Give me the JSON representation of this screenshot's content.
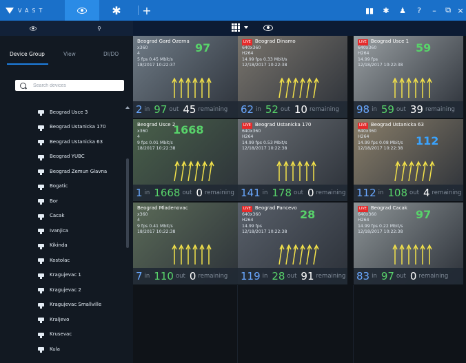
{
  "app": {
    "logo_text": "VAST"
  },
  "toolbar": {
    "colors": {
      "accent": "#1a70c9",
      "live_badge": "#e52b2b",
      "in_count": "#6aa8ff",
      "out_count": "#58d36a"
    },
    "icons": [
      "eye-icon",
      "gear-icon",
      "plus-icon",
      "gear-icon",
      "person-icon",
      "help-icon",
      "minimize-icon",
      "restore-icon",
      "close-icon"
    ]
  },
  "sidebar": {
    "tabs": [
      "Device Group",
      "View",
      "DI/DO"
    ],
    "search_placeholder": "Search devices",
    "devices": [
      "Beograd Usce 3",
      "Beograd Ustanicka 170",
      "Beograd Ustanicka 63",
      "Beograd YUBC",
      "Beograd Zemun Glavna",
      "Bogatic",
      "Bor",
      "Cacak",
      "Ivanjica",
      "Kikinda",
      "Kostolac",
      "Kragujevac 1",
      "Kragujevac 2",
      "Kragujevac Smallville",
      "Kraljevo",
      "Krusevac",
      "Kula"
    ]
  },
  "tiles": [
    {
      "name": "Beograd Gard Ozerna",
      "live": false,
      "res": "x360",
      "codec": "4",
      "fps": "5 fps 0.45 Mbit/s",
      "ts": "18/2017 10:22:37",
      "counter": "97",
      "in": "2",
      "out": "97",
      "remaining": "45",
      "bg": "#6f7b86"
    },
    {
      "name": "Beograd Dinamo",
      "live": true,
      "res": "640x360",
      "codec": "H264",
      "fps": "14.99 fps 0.33 Mbit/s",
      "ts": "12/18/2017 10:22:38",
      "counter": "",
      "in": "62",
      "out": "52",
      "remaining": "10",
      "bg": "#7a756d"
    },
    {
      "name": "Beograd Usce 1",
      "live": true,
      "res": "640x360",
      "codec": "H264",
      "fps": "14.99 fps",
      "ts": "12/18/2017 10:22:38",
      "counter": "59",
      "in": "98",
      "out": "59",
      "remaining": "39",
      "bg": "#9aa0a3"
    },
    {
      "name": "Beograd Usce 2",
      "live": false,
      "res": "x360",
      "codec": "4",
      "fps": "9 fps 0.01 Mbit/s",
      "ts": "18/2017 10:22:38",
      "counter": "1668",
      "in": "1",
      "out": "1668",
      "remaining": "0",
      "bg": "#49604a"
    },
    {
      "name": "Beograd Ustanicka 170",
      "live": true,
      "res": "640x360",
      "codec": "H264",
      "fps": "14.99 fps 0.53 Mbit/s",
      "ts": "12/18/2017 10:22:38",
      "counter": "",
      "in": "141",
      "out": "178",
      "remaining": "0",
      "bg": "#6a6f74"
    },
    {
      "name": "Beograd Ustanicka 63",
      "live": true,
      "res": "640x360",
      "codec": "H264",
      "fps": "14.99 fps 0.08 Mbit/s",
      "ts": "12/18/2017 10:22:38",
      "counter": "112",
      "in": "112",
      "out": "108",
      "remaining": "4",
      "bg": "#8a7f6a"
    },
    {
      "name": "Beograd Mladenovac",
      "live": false,
      "res": "x360",
      "codec": "4",
      "fps": "9 fps 0.41 Mbit/s",
      "ts": "18/2017 10:22:38",
      "counter": "",
      "in": "7",
      "out": "110",
      "remaining": "0",
      "bg": "#5b6b58"
    },
    {
      "name": "Beograd Pancevo",
      "live": true,
      "res": "640x360",
      "codec": "H264",
      "fps": "14.99 fps",
      "ts": "12/18/2017 10:22:38",
      "counter": "28",
      "in": "119",
      "out": "28",
      "remaining": "91",
      "bg": "#59606a"
    },
    {
      "name": "Beograd Cacak",
      "live": true,
      "res": "640x360",
      "codec": "H264",
      "fps": "14.99 fps 0.22 Mbit/s",
      "ts": "12/18/2017 10:22:38",
      "counter": "97",
      "in": "83",
      "out": "97",
      "remaining": "0",
      "bg": "#8e9597"
    }
  ],
  "labels": {
    "in": "in",
    "out": "out",
    "remaining": "remaining",
    "live": "LIVE"
  }
}
